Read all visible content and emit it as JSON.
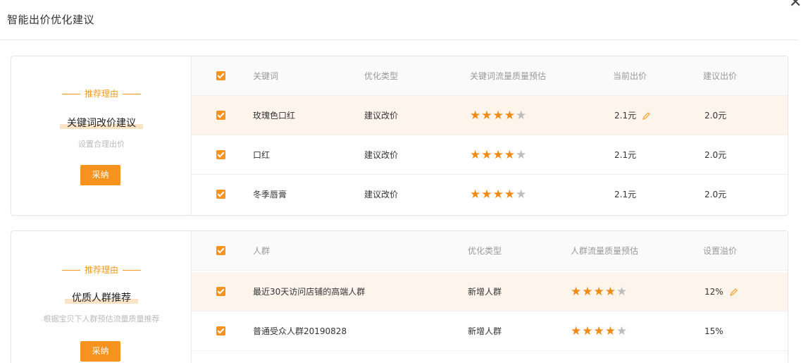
{
  "dialog": {
    "title": "智能出价优化建议",
    "close_glyph": "✕"
  },
  "colors": {
    "accent": "#f6921e",
    "star_on": "#f08a17",
    "star_off": "#bdbdbd",
    "highlight_row": "#fdf5ec"
  },
  "icons": {
    "close": "close-icon",
    "check": "checkbox-check-icon",
    "star": "star-icon",
    "edit": "pencil-icon"
  },
  "sections": [
    {
      "reason_label": "推荐理由",
      "name": "关键词改价建议",
      "desc": "设置合理出价",
      "adopt_label": "采纳",
      "headers": [
        "关键词",
        "优化类型",
        "关键词流量质量预估",
        "当前出价",
        "建议出价"
      ],
      "rows": [
        {
          "keyword": "玫瑰色口红",
          "type": "建议改价",
          "stars": 4,
          "current": "2.1元",
          "suggest": "2.0元",
          "editable": true,
          "highlight": true
        },
        {
          "keyword": "口红",
          "type": "建议改价",
          "stars": 4,
          "current": "2.1元",
          "suggest": "2.0元",
          "editable": false,
          "highlight": false
        },
        {
          "keyword": "冬季唇膏",
          "type": "建议改价",
          "stars": 4,
          "current": "2.1元",
          "suggest": "2.0元",
          "editable": false,
          "highlight": false
        }
      ]
    },
    {
      "reason_label": "推荐理由",
      "name": "优质人群推荐",
      "desc": "根据宝贝下人群预估流量质量推荐",
      "adopt_label": "采纳",
      "headers": [
        "人群",
        "优化类型",
        "人群流量质量预估",
        "设置溢价"
      ],
      "rows": [
        {
          "crowd": "最近30天访问店铺的高端人群",
          "type": "新增人群",
          "stars": 4,
          "premium": "12%",
          "editable": true,
          "highlight": true
        },
        {
          "crowd": "普通受众人群20190828",
          "type": "新增人群",
          "stars": 4,
          "premium": "15%",
          "editable": false,
          "highlight": false
        }
      ]
    }
  ]
}
